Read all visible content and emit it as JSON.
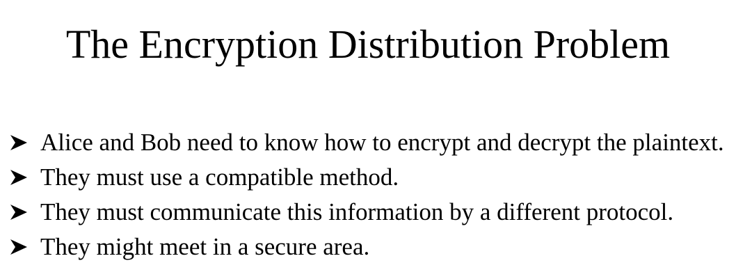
{
  "slide": {
    "title": "The Encryption Distribution Problem",
    "bullet_icon": "arrowhead-bullet-icon",
    "bullets": [
      {
        "text": "Alice and Bob need to know how to encrypt and decrypt the plaintext."
      },
      {
        "text": "They must use a compatible method."
      },
      {
        "text": "They must communicate this information by a different protocol."
      },
      {
        "text": "They might meet in a secure area."
      }
    ]
  }
}
